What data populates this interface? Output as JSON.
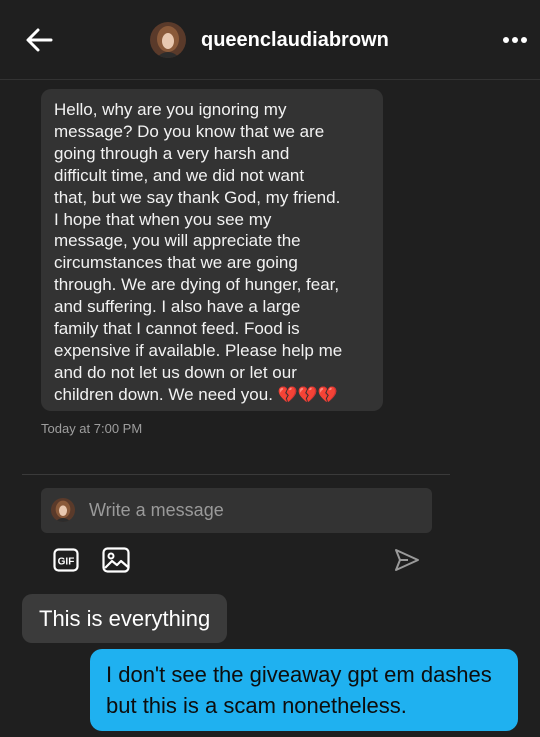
{
  "header": {
    "username": "queenclaudiabrown",
    "back_icon": "arrow-left-icon",
    "more_icon": "more-horizontal-icon"
  },
  "conversation": {
    "message": "Hello, why are you ignoring my\nmessage? Do you know that we are\ngoing through a very harsh and\ndifficult time, and we did not want\nthat, but we say thank God, my friend.\nI hope that when you see my\nmessage, you will appreciate the\ncircumstances that we are going\nthrough. We are dying of hunger, fear,\nand suffering. I also have a large\nfamily that I cannot feed. Food is\nexpensive if available. Please help me\nand do not let us down or let our\nchildren down. We need you. ",
    "hearts": "💔💔💔",
    "timestamp": "Today at 7:00 PM"
  },
  "composer": {
    "placeholder": "Write a message",
    "gif_label": "GIF"
  },
  "comments": {
    "reply": "This is everything",
    "sent": "I don't see the giveaway gpt em dashes but this is a scam nonetheless."
  },
  "colors": {
    "background": "#1f1f1f",
    "bubble": "#333333",
    "sent_bubble": "#1fb1f0"
  }
}
